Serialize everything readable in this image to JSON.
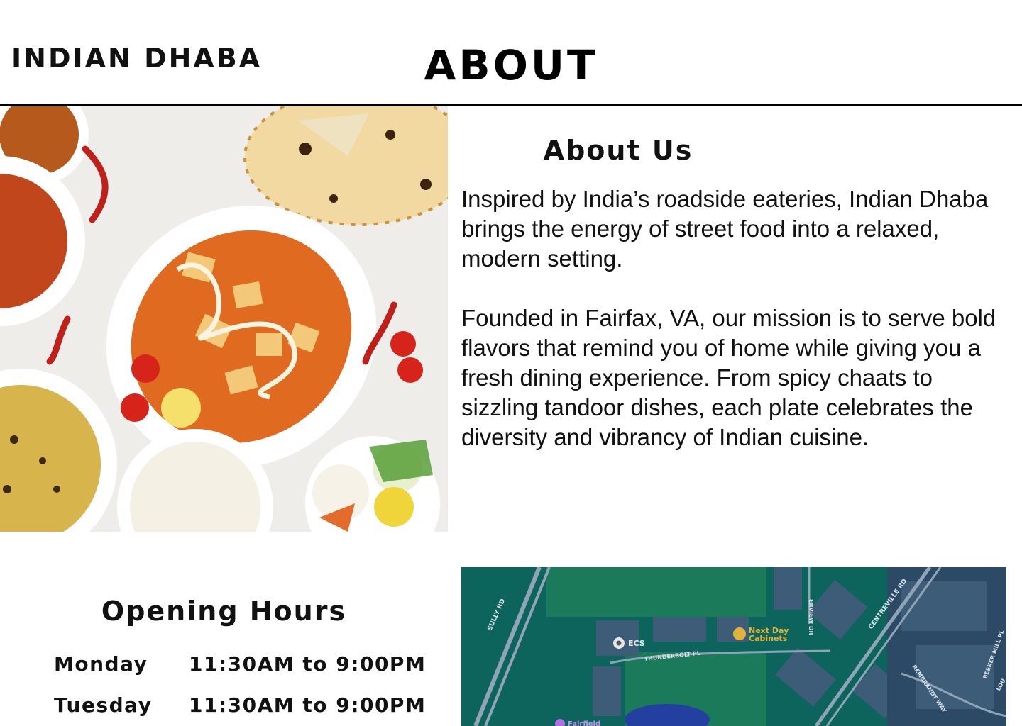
{
  "header": {
    "brand": "INDIAN DHABA",
    "page_title": "ABOUT"
  },
  "about": {
    "heading": "About Us",
    "paragraphs": [
      "Inspired by India’s roadside eateries, Indian Dhaba brings the energy of street food into a relaxed, modern setting.",
      "Founded in Fairfax, VA, our mission is to serve bold flavors that remind you of home while giving you a fresh dining experience. From spicy chaats to sizzling tandoor dishes, each plate celebrates the diversity and vibrancy of Indian cuisine."
    ]
  },
  "hours": {
    "heading": "Opening Hours",
    "rows": [
      {
        "day": "Monday",
        "time": "11:30AM to 9:00PM"
      },
      {
        "day": "Tuesday",
        "time": "11:30AM to 9:00PM"
      }
    ]
  },
  "map": {
    "labels": {
      "sully": "SULLY RD",
      "centreville": "CENTREVILLE RD",
      "erview": "ERVIEW DR",
      "thunderbolt": "THUNDERBOLT PL",
      "ecs": "ECS",
      "nextday_1": "Next Day",
      "nextday_2": "Cabinets",
      "rembrandt": "REMBRANDT WAY",
      "beeker": "BEEKER MILL PL",
      "lou": "LOU",
      "fairfield": "Fairfield"
    },
    "colors": {
      "background": "#0b5a5a",
      "buildings": "#3d5c78",
      "roads": "#8fa4b8",
      "poi": "#e0b43a"
    }
  },
  "photo": {
    "icon": "food-photo-image"
  }
}
